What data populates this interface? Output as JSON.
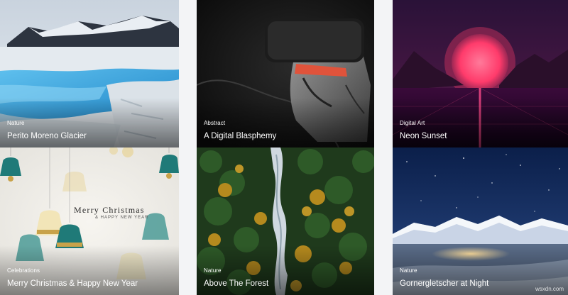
{
  "cards": [
    {
      "category": "Nature",
      "title": "Perito Moreno Glacier"
    },
    {
      "category": "Abstract",
      "title": "A Digital Blasphemy"
    },
    {
      "category": "Digital Art",
      "title": "Neon Sunset"
    },
    {
      "category": "Celebrations",
      "title": "Merry Christmas & Happy New Year"
    },
    {
      "category": "Nature",
      "title": "Above The Forest"
    },
    {
      "category": "Nature",
      "title": "Gornergletscher at Night"
    }
  ],
  "greeting": {
    "headline": "Merry Christmas",
    "subline": "& HAPPY NEW YEAR"
  },
  "watermark": "wsxdn.com",
  "colors": {
    "card_text": "#ffffff",
    "page_background": "#f3f4f6",
    "neon_sun": "#ff3b6b",
    "glacier_water": "#3aa0d8"
  }
}
